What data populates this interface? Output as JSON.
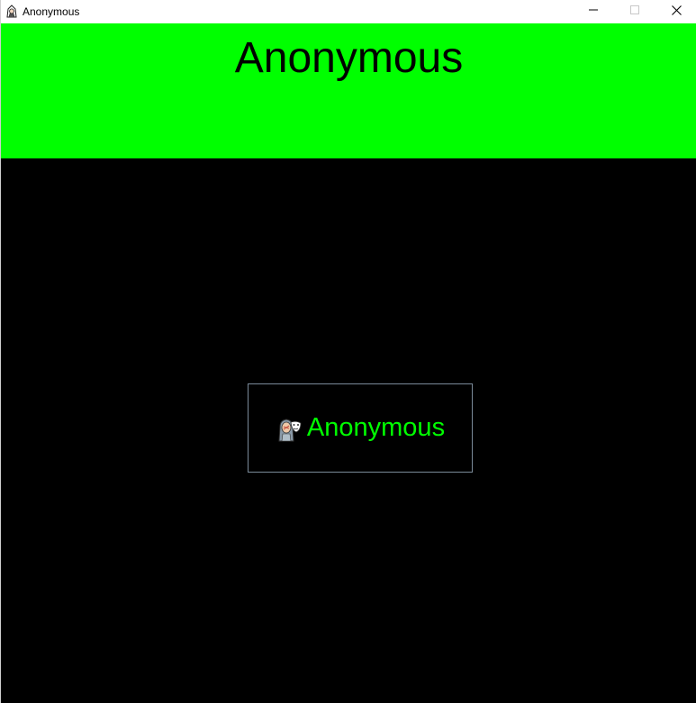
{
  "window": {
    "title": "Anonymous",
    "icon": "hooded-figure-icon",
    "controls": {
      "minimize": "minimize-icon",
      "maximize": "maximize-icon",
      "close": "close-icon"
    }
  },
  "header": {
    "title": "Anonymous",
    "background": "#00ff00",
    "text_color": "#000000"
  },
  "main": {
    "background": "#000000",
    "button": {
      "label": "Anonymous",
      "icon": "anonymous-masks-icon",
      "text_color": "#00ff00",
      "border_color": "#7a8a99"
    }
  }
}
